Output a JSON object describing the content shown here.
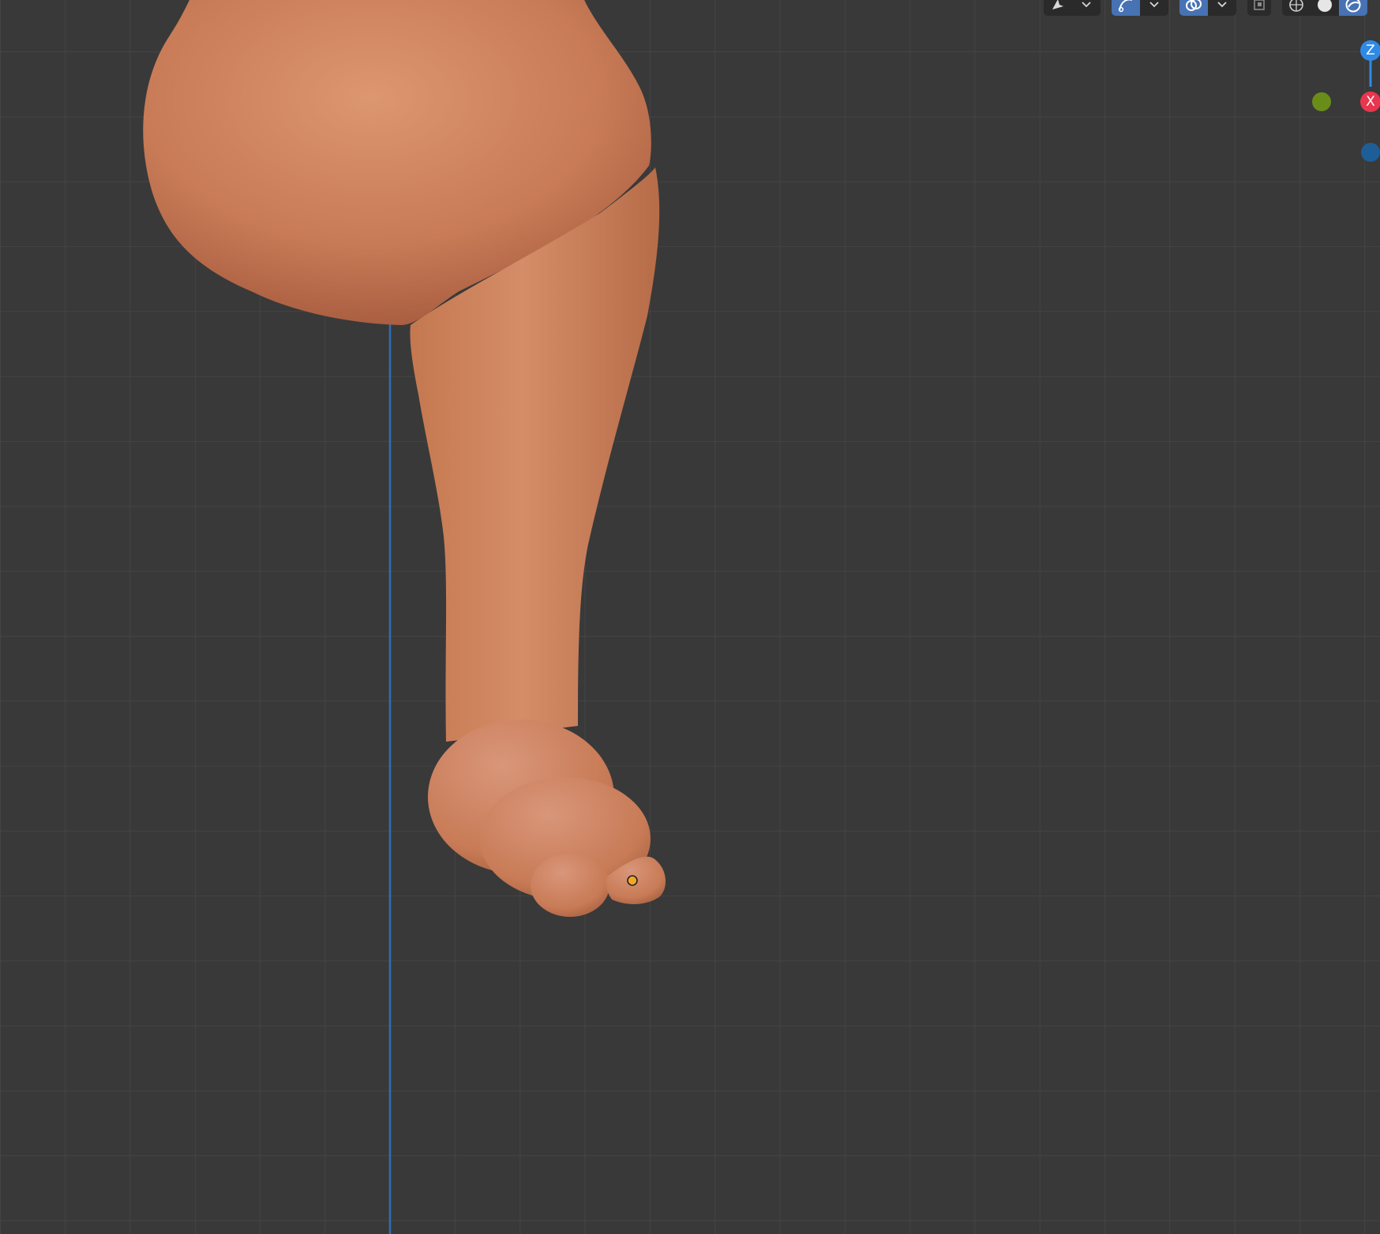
{
  "viewport": {
    "background": "#393939",
    "grid_line_color": "#4a4a4a",
    "axis_line_color": "#2f6fb6",
    "model_color": "#c87b56",
    "origin_marker_color": "#f5a623"
  },
  "header": {
    "select_tool_icon": "cursor-select-icon",
    "snap_icon": "snap-curve-icon",
    "overlay_icon": "overlay-icon",
    "xray_icon": "xray-toggle-icon",
    "shading_icons": [
      "wireframe-shading-icon",
      "solid-shading-icon",
      "material-shading-icon"
    ]
  },
  "gizmo": {
    "z_label": "Z",
    "x_label": "X",
    "z_color": "#2f8ae5",
    "x_color": "#e8364f",
    "y_color": "#6a8d1a",
    "neg_z_color": "#1d5e97"
  }
}
